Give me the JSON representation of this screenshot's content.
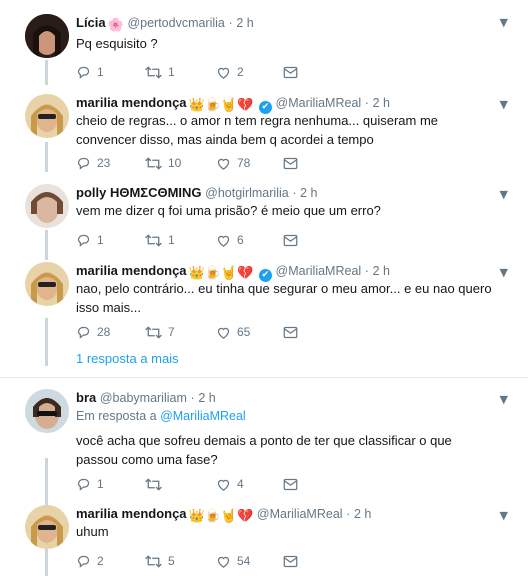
{
  "tweets": [
    {
      "name": "Lícia",
      "name_emoji": "🌸",
      "handle": "@pertodvcmarilia",
      "time": "2 h",
      "text": "Pq esquisito ?",
      "replies": "1",
      "retweets": "1",
      "likes": "2"
    },
    {
      "name": "marilia mendonça",
      "name_emoji": "👑🍺🤘💔",
      "verified": true,
      "handle": "@MariliaMReal",
      "time": "2 h",
      "text": "cheio de regras... o amor n tem regra nenhuma... quiseram me convencer disso, mas ainda bem q acordei a tempo",
      "replies": "23",
      "retweets": "10",
      "likes": "78"
    },
    {
      "name": "polly HΘMΣCΘMING",
      "handle": "@hotgirlmarilia",
      "time": "2 h",
      "text": "vem me dizer q foi uma prisão? é meio que um erro?",
      "replies": "1",
      "retweets": "1",
      "likes": "6"
    },
    {
      "name": "marilia mendonça",
      "name_emoji": "👑🍺🤘💔",
      "verified": true,
      "handle": "@MariliaMReal",
      "time": "2 h",
      "text": "nao, pelo contrário... eu tinha que segurar o meu amor... e eu nao quero isso mais...",
      "replies": "28",
      "retweets": "7",
      "likes": "65"
    },
    {
      "name": "bra",
      "handle": "@babymariliam",
      "time": "2 h",
      "reply_prefix": "Em resposta a",
      "reply_handle": "@MariliaMReal",
      "text": "você acha que sofreu demais a ponto de ter que classificar o que passou como uma fase?",
      "replies": "1",
      "retweets": "",
      "likes": "4"
    },
    {
      "name": "marilia mendonça",
      "name_emoji": "👑🍺🤘💔",
      "handle": "@MariliaMReal",
      "time": "2 h",
      "text": "uhum",
      "replies": "2",
      "retweets": "5",
      "likes": "54"
    }
  ],
  "show_more": "1 resposta a mais",
  "separator_dot": "·",
  "icons": [
    "reply-icon",
    "retweet-icon",
    "like-icon",
    "message-icon",
    "caret-down-icon",
    "verified-badge-icon"
  ],
  "colors": {
    "accent": "#1da1f2",
    "muted": "#657786",
    "thread": "#cdd5dc",
    "text": "#14171a"
  }
}
